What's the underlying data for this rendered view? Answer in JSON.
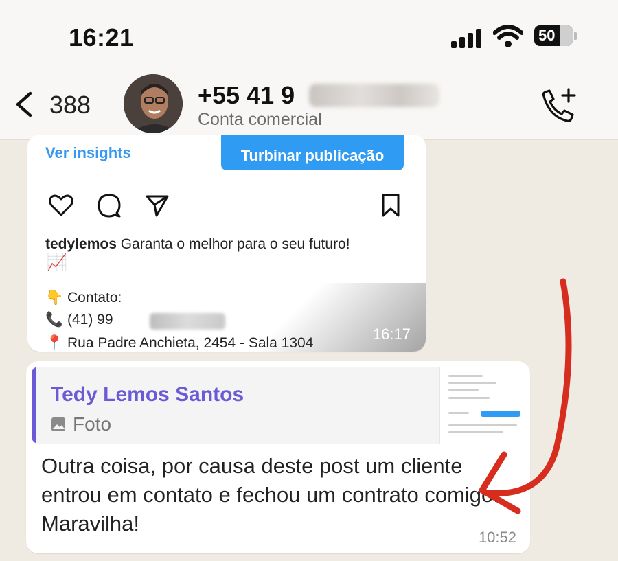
{
  "status_bar": {
    "time": "16:21",
    "battery": "50"
  },
  "header": {
    "back_count": "388",
    "contact_name": "+55 41 9",
    "contact_subtitle": "Conta comercial"
  },
  "post": {
    "ver_insights": "Ver insights",
    "boost_button": "Turbinar publicação",
    "caption_user": "tedylemos",
    "caption_text": "Garanta o melhor para o seu futuro!",
    "chart_emoji": "📈",
    "contato_label": "👇 Contato:",
    "phone_prefix": "📞 (41) 99",
    "address": "📍 Rua Padre Anchieta, 2454 - Sala 1304",
    "time": "16:17"
  },
  "reply": {
    "quoted_author": "Tedy Lemos Santos",
    "quoted_type": "Foto",
    "message": "Outra coisa, por causa deste post um cliente entrou em contato e fechou um contrato comigo. Maravilha!",
    "time": "10:52"
  },
  "colors": {
    "accent_blue": "#2f9bf2",
    "quote_purple": "#6b5ad6",
    "annotation_red": "#d62d1f",
    "chat_background": "#efeae2"
  }
}
